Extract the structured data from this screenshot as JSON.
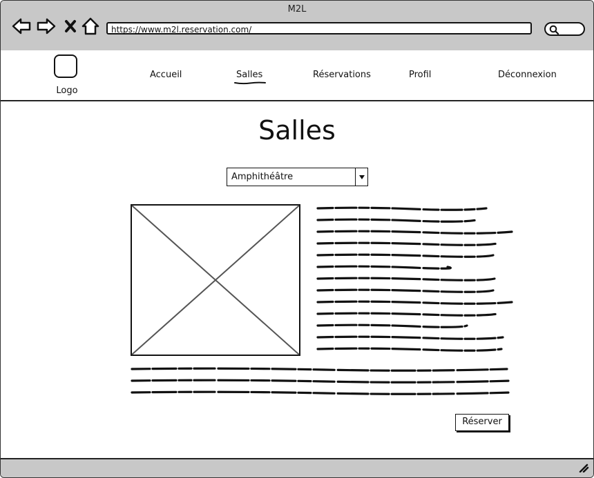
{
  "window": {
    "title": "M2L"
  },
  "browser": {
    "url": "https://www.m2l.reservation.com/",
    "back_icon": "arrow-left-icon",
    "forward_icon": "arrow-right-icon",
    "stop_icon": "close-icon",
    "home_icon": "home-icon",
    "search_icon": "search-icon"
  },
  "header": {
    "logo_label": "Logo",
    "nav": [
      {
        "label": "Accueil"
      },
      {
        "label": "Salles",
        "active": true
      },
      {
        "label": "Réservations"
      },
      {
        "label": "Profil"
      },
      {
        "label": "Déconnexion"
      }
    ]
  },
  "main": {
    "title": "Salles",
    "room_select": {
      "value": "Amphithéâtre"
    },
    "image_placeholder": "image-placeholder",
    "reserve_button": "Réserver"
  },
  "colors": {
    "chrome": "#c8c8c8",
    "ink": "#111111"
  }
}
